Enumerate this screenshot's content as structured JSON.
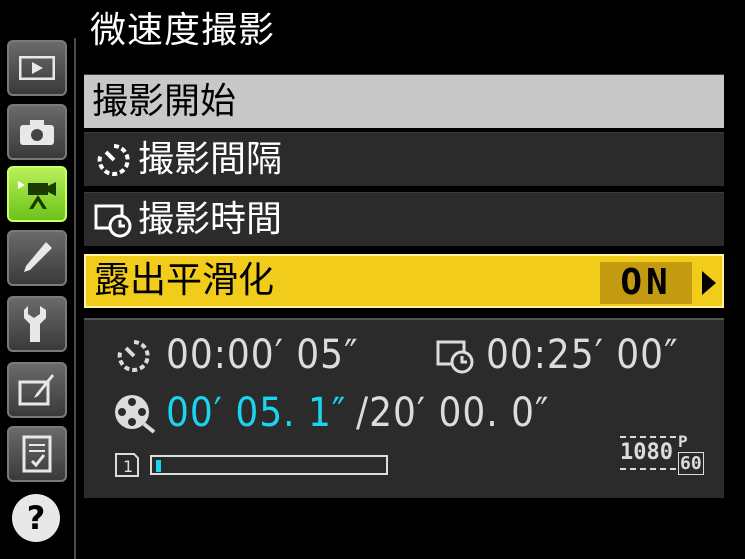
{
  "title": "微速度撮影",
  "menu": [
    {
      "label": "撮影開始"
    },
    {
      "label": "撮影間隔"
    },
    {
      "label": "撮影時間"
    },
    {
      "label": "露出平滑化",
      "value": "ON"
    }
  ],
  "info": {
    "interval": "00:00′ 05″",
    "shooting_time": "00:25′ 00″",
    "movie_length_current": "00′ 05. 1″",
    "movie_length_total": "/20′ 00. 0″",
    "memory_used_fraction": 0.02,
    "resolution": "1080",
    "frame_rate_letter": "P",
    "frame_rate": "60"
  },
  "tabs": [
    {
      "icon": "playback-icon"
    },
    {
      "icon": "camera-icon"
    },
    {
      "icon": "movie-icon",
      "active": true
    },
    {
      "icon": "pencil-icon"
    },
    {
      "icon": "wrench-icon"
    },
    {
      "icon": "retouch-icon"
    },
    {
      "icon": "recent-settings-icon"
    },
    {
      "icon": "help-icon"
    }
  ],
  "colors": {
    "accent": "#f2cc1a",
    "cyan": "#19d5f0",
    "tab_active": "#8ed73a"
  }
}
